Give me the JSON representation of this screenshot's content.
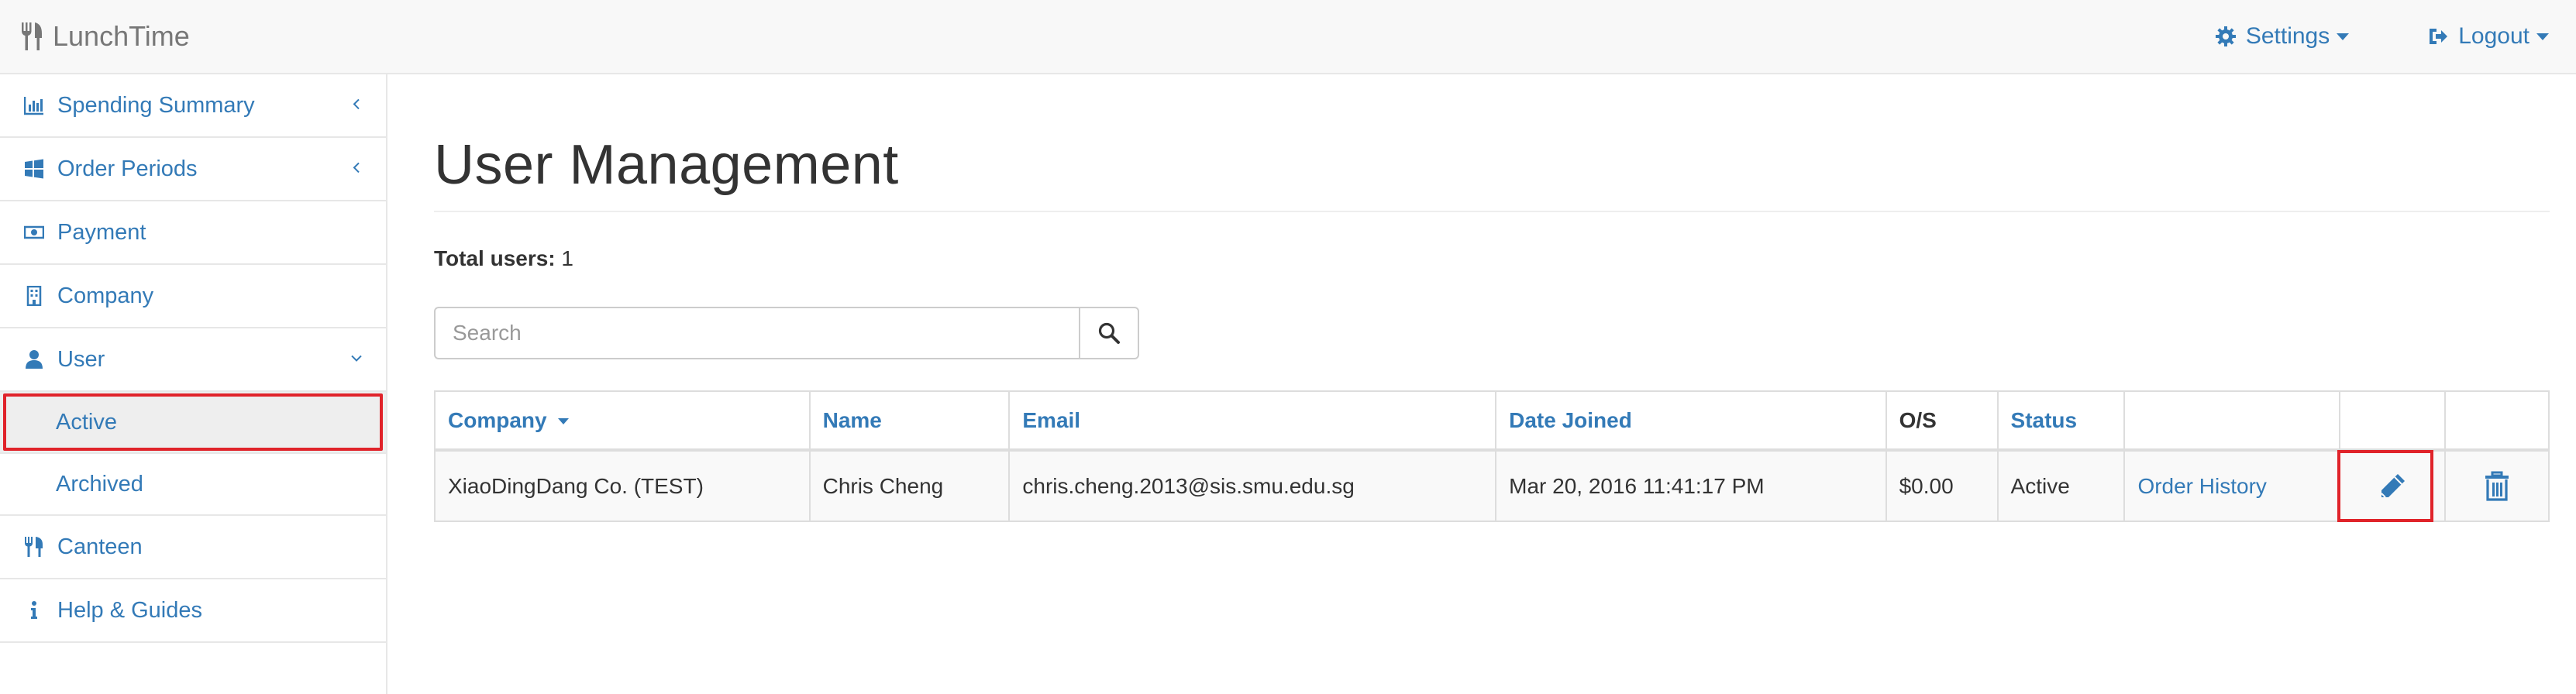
{
  "app": {
    "brand": "LunchTime",
    "brand_icon": "cutlery-icon"
  },
  "navbar": {
    "settings_label": "Settings",
    "settings_icon": "gear-icon",
    "logout_label": "Logout",
    "logout_icon": "sign-out-icon"
  },
  "sidebar": {
    "items": [
      {
        "label": "Spending Summary",
        "icon": "bar-chart-icon",
        "expandable": true,
        "expanded": false
      },
      {
        "label": "Order Periods",
        "icon": "windows-icon",
        "expandable": true,
        "expanded": false
      },
      {
        "label": "Payment",
        "icon": "money-icon",
        "expandable": false
      },
      {
        "label": "Company",
        "icon": "building-icon",
        "expandable": false
      },
      {
        "label": "User",
        "icon": "user-icon",
        "expandable": true,
        "expanded": true
      },
      {
        "label": "Canteen",
        "icon": "cutlery-icon",
        "expandable": false
      },
      {
        "label": "Help & Guides",
        "icon": "info-icon",
        "expandable": false
      }
    ],
    "user_subitems": [
      {
        "label": "Active",
        "selected": true
      },
      {
        "label": "Archived",
        "selected": false
      }
    ]
  },
  "main": {
    "title": "User Management",
    "total_label": "Total users:",
    "total_value": "1",
    "search": {
      "placeholder": "Search",
      "value": ""
    }
  },
  "table": {
    "columns": [
      "Company",
      "Name",
      "Email",
      "Date Joined",
      "O/S",
      "Status",
      "",
      "",
      ""
    ],
    "sorted_column": "Company",
    "rows": [
      {
        "company": "XiaoDingDang Co. (TEST)",
        "name": "Chris Cheng",
        "email": "chris.cheng.2013@sis.smu.edu.sg",
        "date_joined": "Mar 20, 2016 11:41:17 PM",
        "os": "$0.00",
        "status": "Active",
        "order_history": "Order History",
        "edit_icon": "pencil-icon",
        "delete_icon": "trash-icon"
      }
    ]
  },
  "colors": {
    "link": "#337ab7",
    "navbar_bg": "#f8f8f8",
    "highlight": "#e0232a"
  }
}
